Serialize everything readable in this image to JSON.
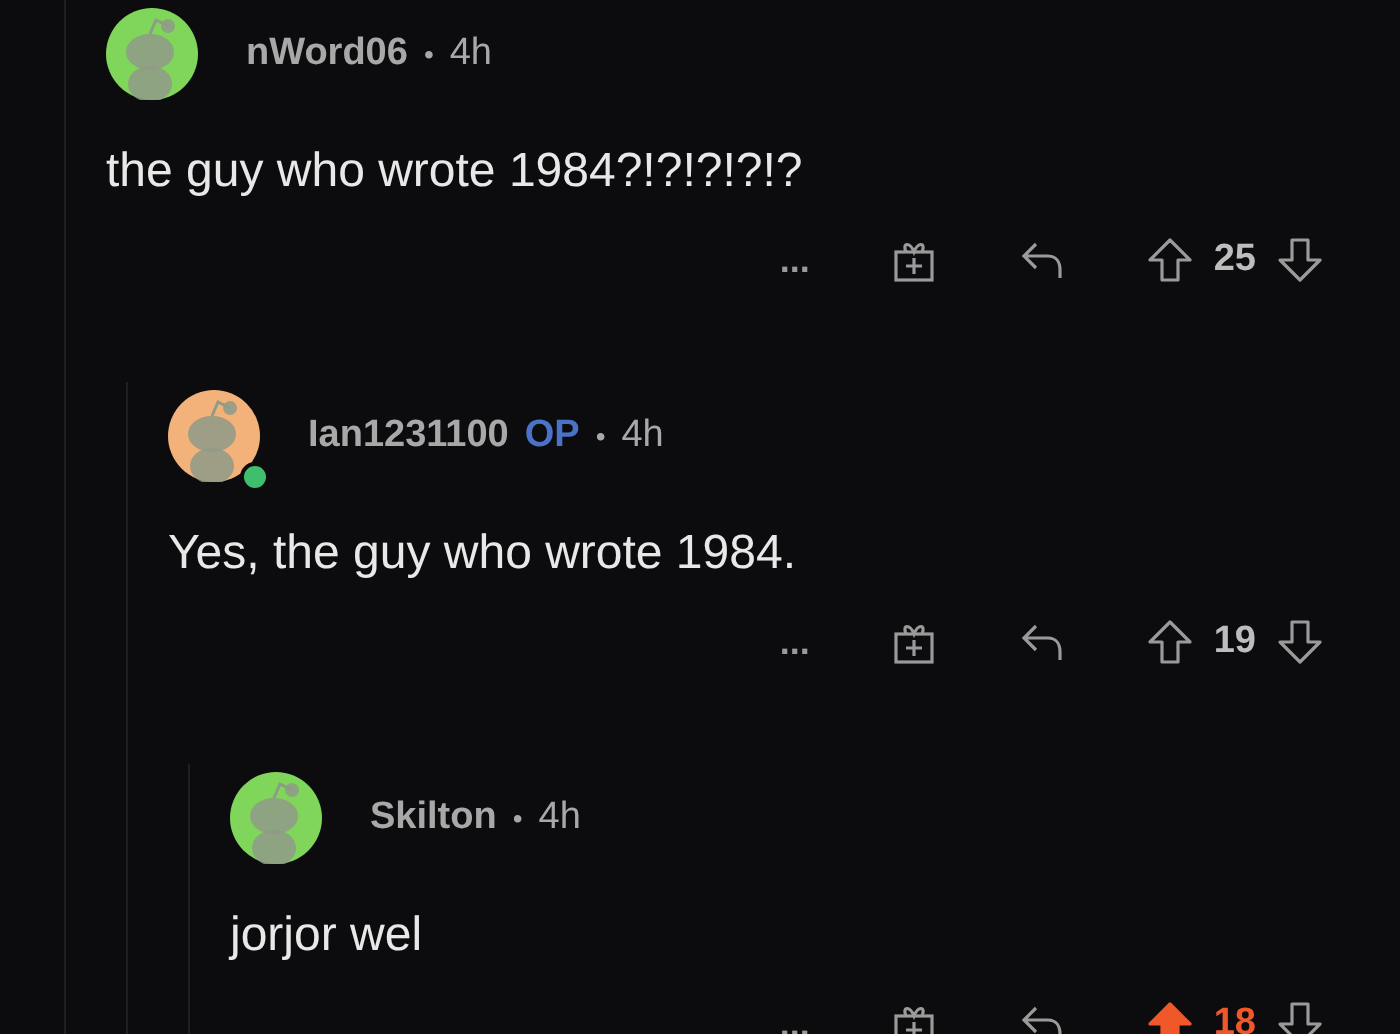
{
  "comments": [
    {
      "author": "nWord06",
      "op": false,
      "dot": "•",
      "age": "4h",
      "color": "#7fd65a",
      "online": false,
      "text": "the guy who wrote 1984?!?!?!?!?",
      "more": "...",
      "score": "25",
      "upvoted": false,
      "children": [
        {
          "author": "Ian1231100",
          "op_label": "OP",
          "op": true,
          "dot": "•",
          "age": "4h",
          "color": "#f2b27a",
          "online": true,
          "text": "Yes, the guy who wrote 1984.",
          "more": "...",
          "score": "19",
          "upvoted": false,
          "children": [
            {
              "author": "Skilton",
              "op": false,
              "dot": "•",
              "age": "4h",
              "color": "#7fd65a",
              "online": false,
              "text": "jorjor wel",
              "more": "...",
              "score": "18",
              "upvoted": true
            }
          ]
        }
      ]
    }
  ]
}
